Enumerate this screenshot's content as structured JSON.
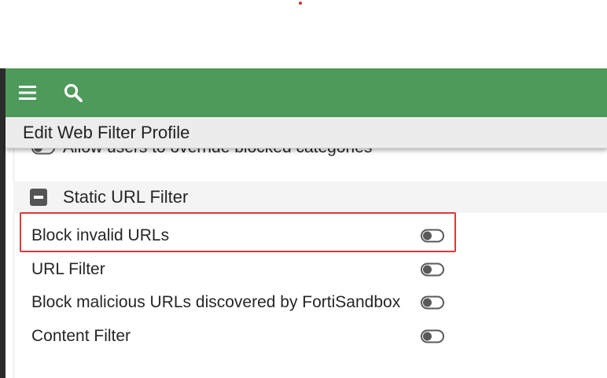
{
  "header": {
    "menu_icon": "hamburger-menu-icon",
    "search_icon": "search-icon",
    "bar_color": "#4d9a5a"
  },
  "breadcrumb": {
    "title": "Edit Web Filter Profile"
  },
  "settings": {
    "override_label": "Allow users to override blocked categories",
    "override_enabled": false
  },
  "static_url_filter": {
    "title": "Static URL Filter",
    "items": [
      {
        "label": "Block invalid URLs",
        "enabled": false,
        "highlighted": true
      },
      {
        "label": "URL Filter",
        "enabled": false
      },
      {
        "label": "Block malicious URLs discovered by FortiSandbox",
        "enabled": false
      },
      {
        "label": "Content Filter",
        "enabled": false
      }
    ]
  },
  "colors": {
    "highlight": "#d93a3a",
    "toggle_off": "#595959"
  }
}
